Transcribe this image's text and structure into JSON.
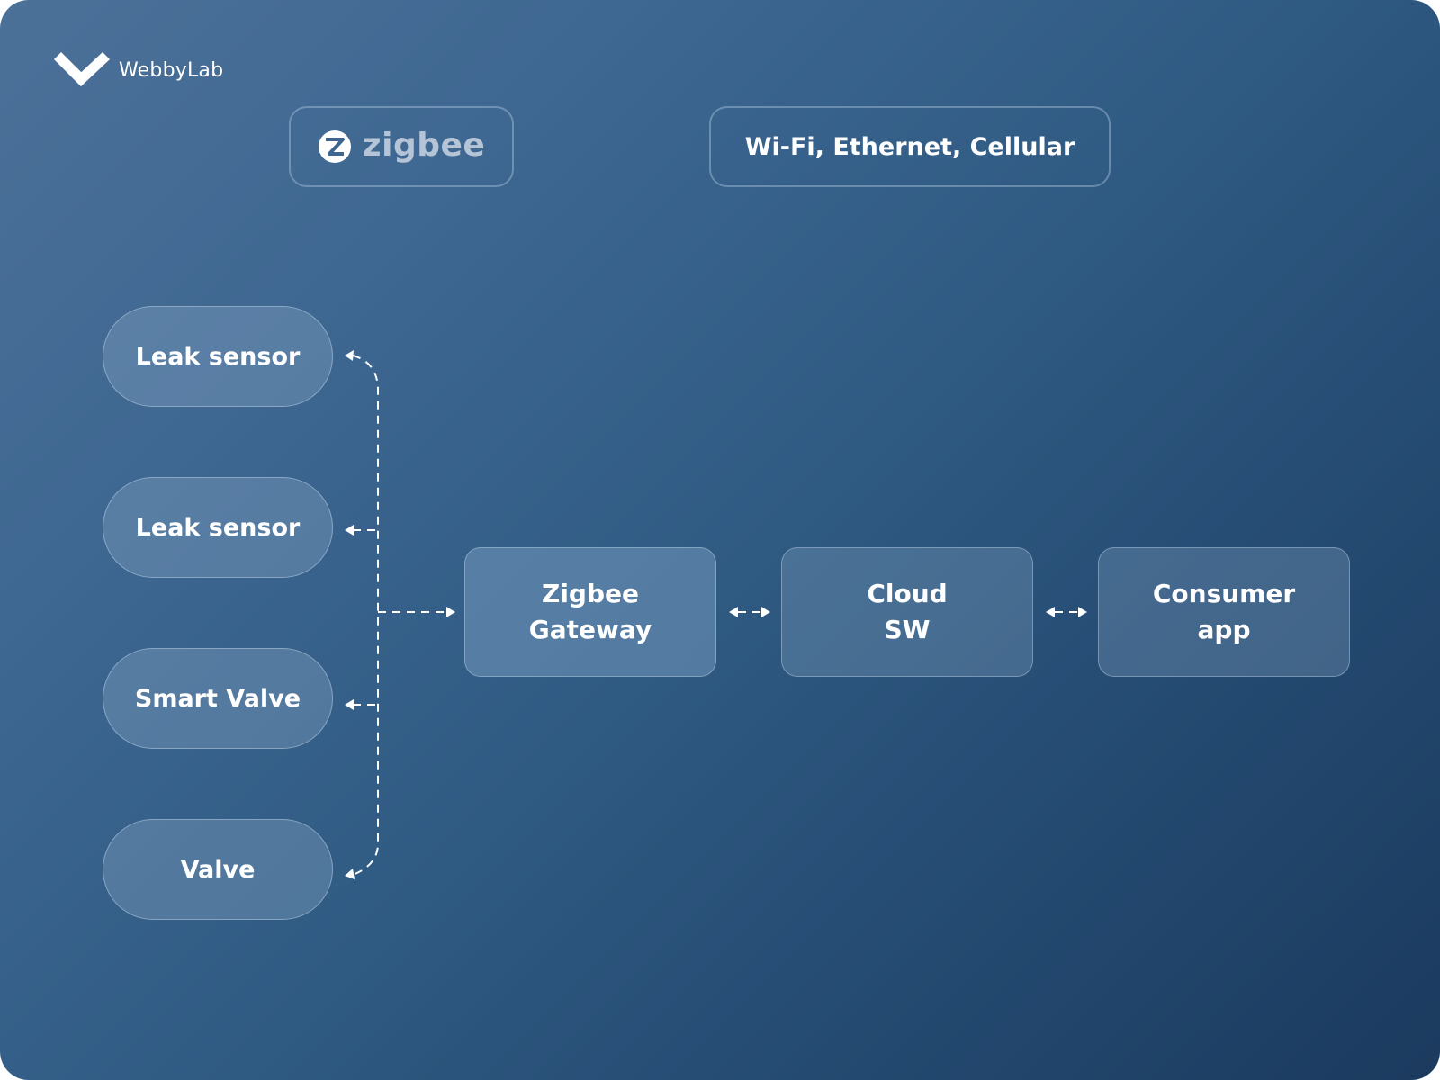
{
  "brand": {
    "logo_icon": "webbylab-logo-icon",
    "name": "WebbyLab"
  },
  "protocols": {
    "zigbee": {
      "icon": "zigbee-logo-icon",
      "label": "zigbee"
    },
    "network": {
      "label": "Wi-Fi, Ethernet, Cellular"
    }
  },
  "devices": [
    {
      "label": "Leak sensor"
    },
    {
      "label": "Leak sensor"
    },
    {
      "label": "Smart Valve"
    },
    {
      "label": "Valve"
    }
  ],
  "nodes": {
    "gateway": {
      "line1": "Zigbee",
      "line2": "Gateway"
    },
    "cloud": {
      "line1": "Cloud",
      "line2": "SW"
    },
    "app": {
      "line1": "Consumer",
      "line2": "app"
    }
  },
  "connections": [
    {
      "from": "Leak sensor",
      "to": "Zigbee Gateway",
      "style": "dashed",
      "direction": "bidirectional"
    },
    {
      "from": "Leak sensor",
      "to": "Zigbee Gateway",
      "style": "dashed",
      "direction": "bidirectional"
    },
    {
      "from": "Smart Valve",
      "to": "Zigbee Gateway",
      "style": "dashed",
      "direction": "bidirectional"
    },
    {
      "from": "Valve",
      "to": "Zigbee Gateway",
      "style": "dashed",
      "direction": "bidirectional"
    },
    {
      "from": "Zigbee Gateway",
      "to": "Cloud SW",
      "style": "dashed",
      "direction": "bidirectional"
    },
    {
      "from": "Cloud SW",
      "to": "Consumer app",
      "style": "dashed",
      "direction": "bidirectional"
    }
  ],
  "colors": {
    "background_start": "#4c7199",
    "background_end": "#1b3a5e",
    "text": "#ffffff",
    "zigbee_text": "#b5c4d6"
  }
}
